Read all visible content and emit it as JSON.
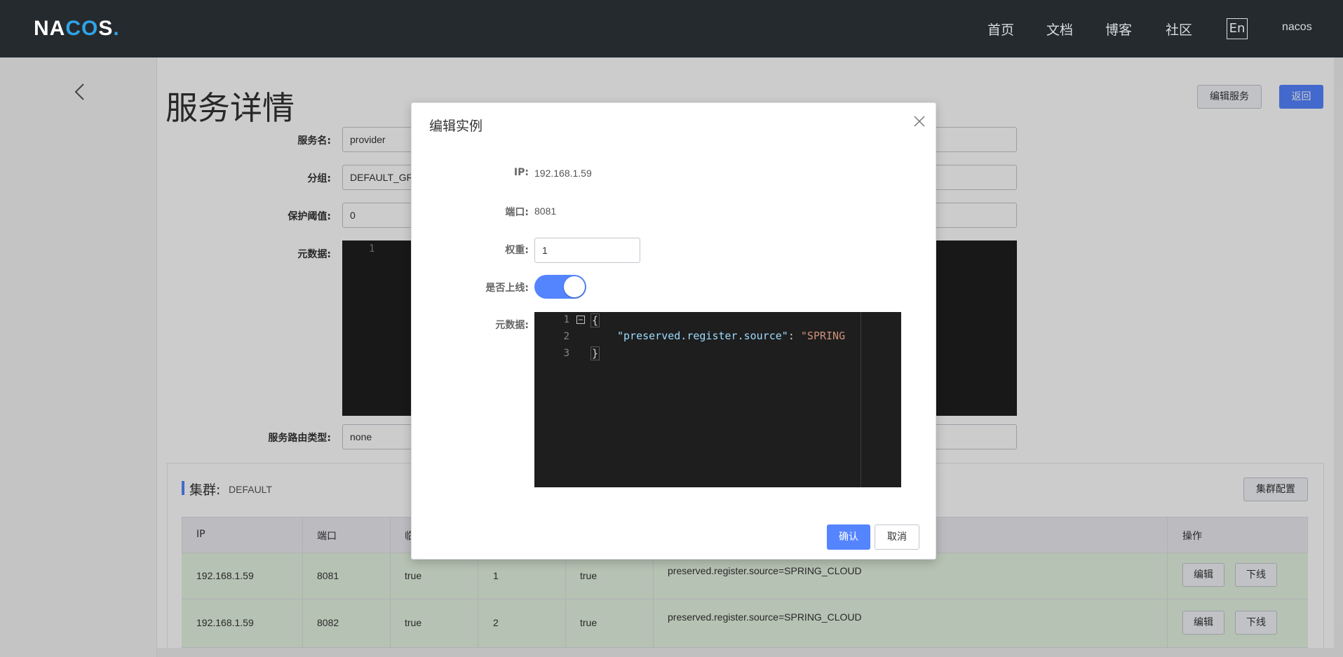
{
  "header": {
    "logo_main": "NA",
    "logo_co": "CO",
    "logo_end": "S",
    "logo_dot": ".",
    "nav": [
      "首页",
      "文档",
      "博客",
      "社区"
    ],
    "lang": "En",
    "user": "nacos"
  },
  "page": {
    "title": "服务详情",
    "edit_service_label": "编辑服务",
    "back_label": "返回",
    "form": {
      "service_name_label": "服务名:",
      "service_name_value": "provider",
      "group_label": "分组:",
      "group_value": "DEFAULT_GR",
      "protect_label": "保护阈值:",
      "protect_value": "0",
      "metadata_label": "元数据:",
      "metadata_line_no": "1",
      "route_type_label": "服务路由类型:",
      "route_type_value": "none"
    },
    "cluster": {
      "title": "集群:",
      "name": "DEFAULT",
      "config_label": "集群配置",
      "columns": [
        "IP",
        "端口",
        "临",
        "",
        "",
        "",
        "操作"
      ],
      "rows": [
        {
          "ip": "192.168.1.59",
          "port": "8081",
          "ephemeral": "true",
          "weight": "1",
          "healthy": "true",
          "metadata": "preserved.register.source=SPRING_CLOUD",
          "edit": "编辑",
          "offline": "下线"
        },
        {
          "ip": "192.168.1.59",
          "port": "8082",
          "ephemeral": "true",
          "weight": "2",
          "healthy": "true",
          "metadata": "preserved.register.source=SPRING_CLOUD",
          "edit": "编辑",
          "offline": "下线"
        }
      ]
    }
  },
  "dialog": {
    "title": "编辑实例",
    "ip_label": "IP:",
    "ip_value": "192.168.1.59",
    "port_label": "端口:",
    "port_value": "8081",
    "weight_label": "权重:",
    "weight_value": "1",
    "online_label": "是否上线:",
    "online": true,
    "metadata_label": "元数据:",
    "code_lines": [
      "1",
      "2",
      "3"
    ],
    "code_open": "{",
    "code_key": "\"preserved.register.source\"",
    "code_colon": ": ",
    "code_val": "\"SPRING",
    "code_close": "}",
    "ok_label": "确认",
    "cancel_label": "取消"
  },
  "colors": {
    "header_bg": "#252a2f",
    "primary": "#5584ff",
    "row_green": "#e4f3e0",
    "editor_bg": "#1e1e1e"
  }
}
